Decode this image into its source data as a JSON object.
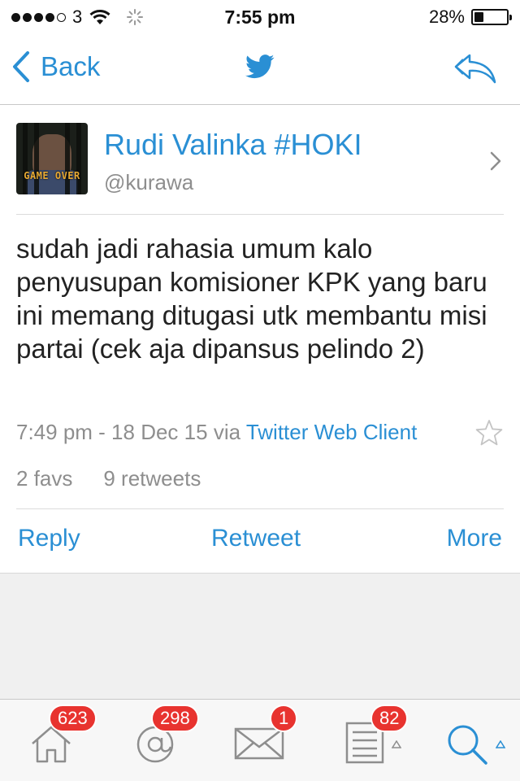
{
  "status_bar": {
    "carrier": "3",
    "time": "7:55 pm",
    "battery": "28%",
    "battery_level": 0.28
  },
  "nav": {
    "back_label": "Back",
    "icons": [
      "back-chevron-icon",
      "twitter-bird-icon",
      "reply-all-icon"
    ],
    "accent_color": "#2a8fd4"
  },
  "tweet": {
    "user_name": "Rudi Valinka #HOKI",
    "handle": "@kurawa",
    "avatar_caption": "GAME OVER",
    "text": "sudah jadi rahasia umum kalo penyusupan komisioner KPK yang baru ini memang ditugasi utk membantu misi partai (cek aja dipansus pelindo 2)",
    "timestamp": "7:49 pm - 18 Dec 15",
    "via_label": "via",
    "client": "Twitter Web Client",
    "favs": "2 favs",
    "retweets": "9 retweets"
  },
  "actions": {
    "reply": "Reply",
    "retweet": "Retweet",
    "more": "More"
  },
  "tab_bar": {
    "tabs": [
      {
        "icon": "home-icon",
        "badge": "623"
      },
      {
        "icon": "mentions-icon",
        "badge": "298"
      },
      {
        "icon": "messages-icon",
        "badge": "1"
      },
      {
        "icon": "lists-icon",
        "badge": "82"
      },
      {
        "icon": "search-icon",
        "badge": ""
      }
    ]
  }
}
